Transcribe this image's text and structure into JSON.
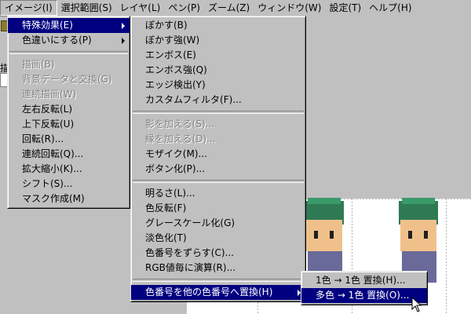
{
  "menubar": [
    {
      "label": "イメージ(I)",
      "active": true
    },
    {
      "label": "選択範囲(S)"
    },
    {
      "label": "レイヤ(L)"
    },
    {
      "label": "ペン(P)"
    },
    {
      "label": "ズーム(Z)"
    },
    {
      "label": "ウィンドウ(W)"
    },
    {
      "label": "設定(T)"
    },
    {
      "label": "ヘルプ(H)"
    }
  ],
  "background": {
    "label_fragment": "描"
  },
  "menu1": {
    "items": [
      {
        "label": "特殊効果(E)",
        "submenu": true,
        "selected": true
      },
      {
        "label": "色違いにする(P)",
        "submenu": true
      },
      {
        "sep": true
      },
      {
        "label": "描画(B)",
        "disabled": true
      },
      {
        "label": "背景データと交換(G)",
        "disabled": true
      },
      {
        "label": "連続描画(W)",
        "disabled": true
      },
      {
        "label": "左右反転(L)"
      },
      {
        "label": "上下反転(U)"
      },
      {
        "label": "回転(R)..."
      },
      {
        "label": "連続回転(Q)..."
      },
      {
        "label": "拡大縮小(K)..."
      },
      {
        "label": "シフト(S)..."
      },
      {
        "label": "マスク作成(M)"
      }
    ]
  },
  "menu2": {
    "items": [
      {
        "label": "ぼかす(B)"
      },
      {
        "label": "ぼかす強(W)"
      },
      {
        "label": "エンボス(E)"
      },
      {
        "label": "エンボス強(Q)"
      },
      {
        "label": "エッジ検出(Y)"
      },
      {
        "label": "カスタムフィルタ(F)..."
      },
      {
        "sep": true
      },
      {
        "label": "影を加える(S)...",
        "disabled": true
      },
      {
        "label": "縁を加える(D)...",
        "disabled": true
      },
      {
        "label": "モザイク(M)..."
      },
      {
        "label": "ボタン化(P)..."
      },
      {
        "sep": true
      },
      {
        "label": "明るさ(L)..."
      },
      {
        "label": "色反転(F)"
      },
      {
        "label": "グレースケール化(G)"
      },
      {
        "label": "淡色化(T)"
      },
      {
        "label": "色番号をずらす(C)..."
      },
      {
        "label": "RGB値毎に演算(R)..."
      },
      {
        "sep": true
      },
      {
        "label": "色番号を他の色番号へ置換(H)",
        "submenu": true,
        "selected": true
      }
    ]
  },
  "menu3": {
    "items": [
      {
        "label": "1色 → 1色 置換(H)..."
      },
      {
        "label": "多色 → 1色 置換(O)...",
        "selected": true
      }
    ]
  },
  "colors": {
    "highlight": "#000080",
    "menu_bg": "#c0c0c0",
    "disabled": "#808080",
    "sprite_hair": "#3a9a6a",
    "sprite_skin": "#f0c08a"
  }
}
